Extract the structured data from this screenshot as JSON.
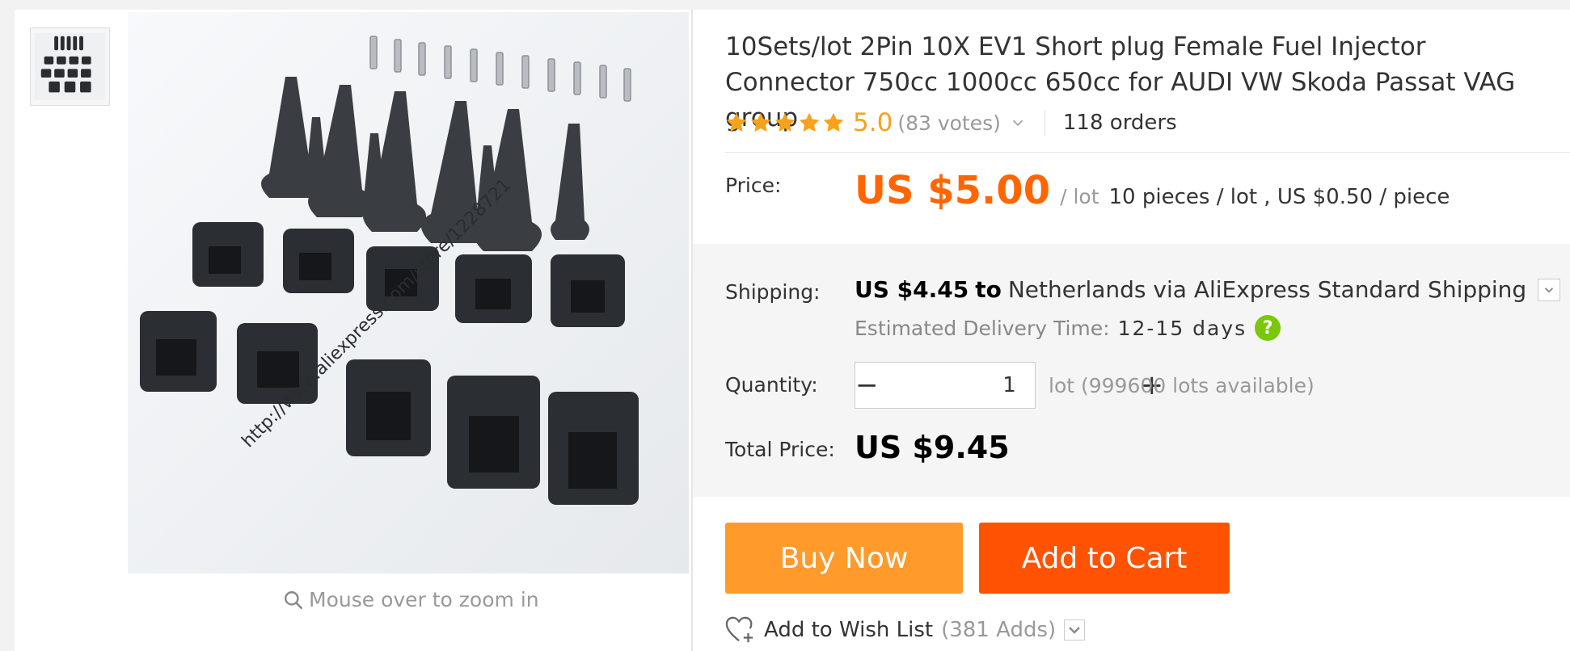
{
  "product": {
    "title": "10Sets/lot 2Pin 10X EV1 Short plug Female Fuel Injector Connector 750cc 1000cc 650cc for AUDI VW Skoda Passat VAG group",
    "image_watermark": "http://www.aliexpress.com/store/1228721",
    "zoom_hint": "Mouse over to zoom in"
  },
  "rating": {
    "score": "5.0",
    "votes": "(83 votes)",
    "orders": "118 orders",
    "stars": 5
  },
  "price": {
    "label": "Price:",
    "value": "US $5.00",
    "unit": "/ lot",
    "detail": "10 pieces / lot , US $0.50 / piece"
  },
  "shipping": {
    "label": "Shipping:",
    "amount": "US $4.45",
    "to": "to",
    "destination": "Netherlands via AliExpress Standard Shipping",
    "eta_label": "Estimated Delivery Time:",
    "eta_value": "12-15 days"
  },
  "quantity": {
    "label": "Quantity:",
    "value": "1",
    "minus": "−",
    "plus": "+",
    "available": "lot (999600 lots available)"
  },
  "total": {
    "label": "Total Price:",
    "value": "US $9.45"
  },
  "actions": {
    "buy_now": "Buy Now",
    "add_to_cart": "Add to Cart",
    "wish_label": "Add to Wish List",
    "wish_adds": "(381 Adds)"
  },
  "colors": {
    "price_orange": "#ff6600",
    "star_orange": "#f7a21b",
    "buy_now_bg": "#ff9a2b",
    "cart_bg": "#ff5202",
    "help_green": "#7ac70c"
  }
}
